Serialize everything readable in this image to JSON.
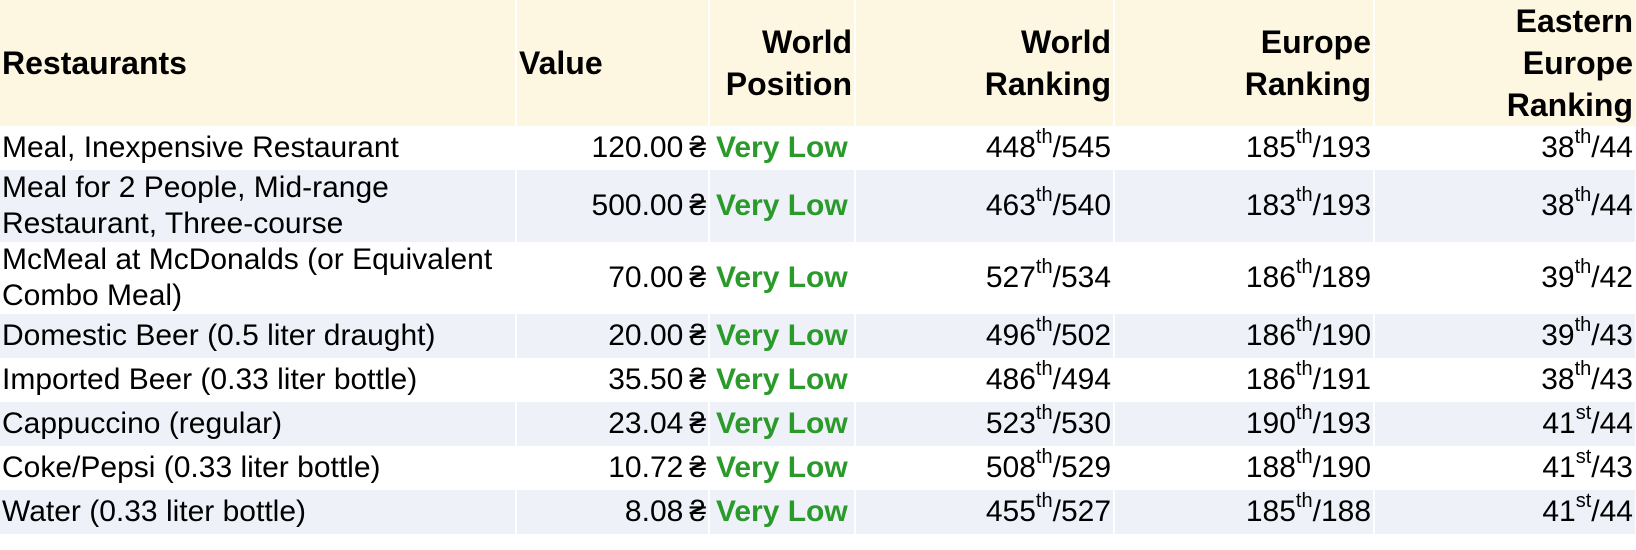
{
  "header": {
    "name": "Restaurants",
    "value": "Value",
    "world_position": [
      "World",
      "Position"
    ],
    "world_ranking": [
      "World",
      "Ranking"
    ],
    "europe_ranking": [
      "Europe",
      "Ranking"
    ],
    "eastern_europe_ranking": [
      "Eastern",
      "Europe",
      "Ranking"
    ]
  },
  "currency": "₴",
  "rows": [
    {
      "name": "Meal, Inexpensive Restaurant",
      "value": "120.00",
      "position": "Very Low",
      "world": {
        "rank": "448",
        "suffix": "th",
        "total": "/545"
      },
      "europe": {
        "rank": "185",
        "suffix": "th",
        "total": "/193"
      },
      "eastern": {
        "rank": "38",
        "suffix": "th",
        "total": "/44"
      }
    },
    {
      "name": "Meal for 2 People, Mid-range Restaurant, Three-course",
      "value": "500.00",
      "position": "Very Low",
      "world": {
        "rank": "463",
        "suffix": "th",
        "total": "/540"
      },
      "europe": {
        "rank": "183",
        "suffix": "th",
        "total": "/193"
      },
      "eastern": {
        "rank": "38",
        "suffix": "th",
        "total": "/44"
      }
    },
    {
      "name": "McMeal at McDonalds (or Equivalent Combo Meal)",
      "value": "70.00",
      "position": "Very Low",
      "world": {
        "rank": "527",
        "suffix": "th",
        "total": "/534"
      },
      "europe": {
        "rank": "186",
        "suffix": "th",
        "total": "/189"
      },
      "eastern": {
        "rank": "39",
        "suffix": "th",
        "total": "/42"
      }
    },
    {
      "name": "Domestic Beer (0.5 liter draught)",
      "value": "20.00",
      "position": "Very Low",
      "world": {
        "rank": "496",
        "suffix": "th",
        "total": "/502"
      },
      "europe": {
        "rank": "186",
        "suffix": "th",
        "total": "/190"
      },
      "eastern": {
        "rank": "39",
        "suffix": "th",
        "total": "/43"
      }
    },
    {
      "name": "Imported Beer (0.33 liter bottle)",
      "value": "35.50",
      "position": "Very Low",
      "world": {
        "rank": "486",
        "suffix": "th",
        "total": "/494"
      },
      "europe": {
        "rank": "186",
        "suffix": "th",
        "total": "/191"
      },
      "eastern": {
        "rank": "38",
        "suffix": "th",
        "total": "/43"
      }
    },
    {
      "name": "Cappuccino (regular)",
      "value": "23.04",
      "position": "Very Low",
      "world": {
        "rank": "523",
        "suffix": "th",
        "total": "/530"
      },
      "europe": {
        "rank": "190",
        "suffix": "th",
        "total": "/193"
      },
      "eastern": {
        "rank": "41",
        "suffix": "st",
        "total": "/44"
      }
    },
    {
      "name": "Coke/Pepsi (0.33 liter bottle)",
      "value": "10.72",
      "position": "Very Low",
      "world": {
        "rank": "508",
        "suffix": "th",
        "total": "/529"
      },
      "europe": {
        "rank": "188",
        "suffix": "th",
        "total": "/190"
      },
      "eastern": {
        "rank": "41",
        "suffix": "st",
        "total": "/43"
      }
    },
    {
      "name": "Water (0.33 liter bottle)",
      "value": "8.08",
      "position": "Very Low",
      "world": {
        "rank": "455",
        "suffix": "th",
        "total": "/527"
      },
      "europe": {
        "rank": "185",
        "suffix": "th",
        "total": "/188"
      },
      "eastern": {
        "rank": "41",
        "suffix": "st",
        "total": "/44"
      }
    }
  ],
  "colors": {
    "header_bg": "#fdf6e0",
    "stripe_bg": "#eef1f8",
    "position_green": "#2a9a2a"
  }
}
